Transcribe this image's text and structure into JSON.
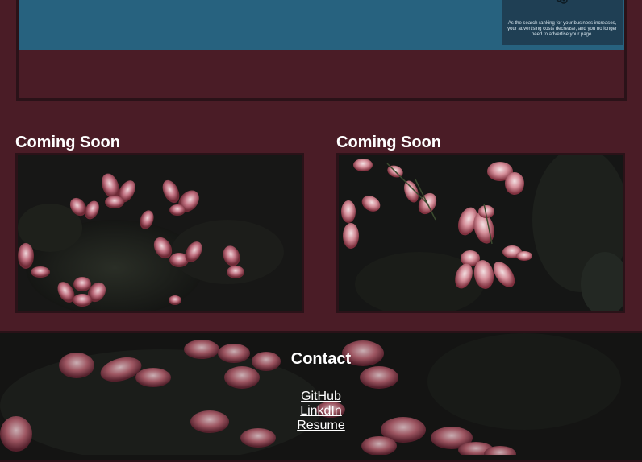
{
  "top_card": {
    "banner_caption": "As the search ranking for your business increases, your advertising costs decrease, and you no longer need to advertise your page."
  },
  "projects": [
    {
      "title": "Coming Soon"
    },
    {
      "title": "Coming Soon"
    }
  ],
  "footer": {
    "heading": "Contact",
    "links": [
      "GitHub",
      "LinkdIn",
      "Resume"
    ]
  },
  "colors": {
    "page_background": "#4a1c26",
    "banner": "#27627f",
    "border": "#2a1218",
    "petal": "#b85a66"
  },
  "icon_names": [
    "flower-photo",
    "gears-icon"
  ]
}
